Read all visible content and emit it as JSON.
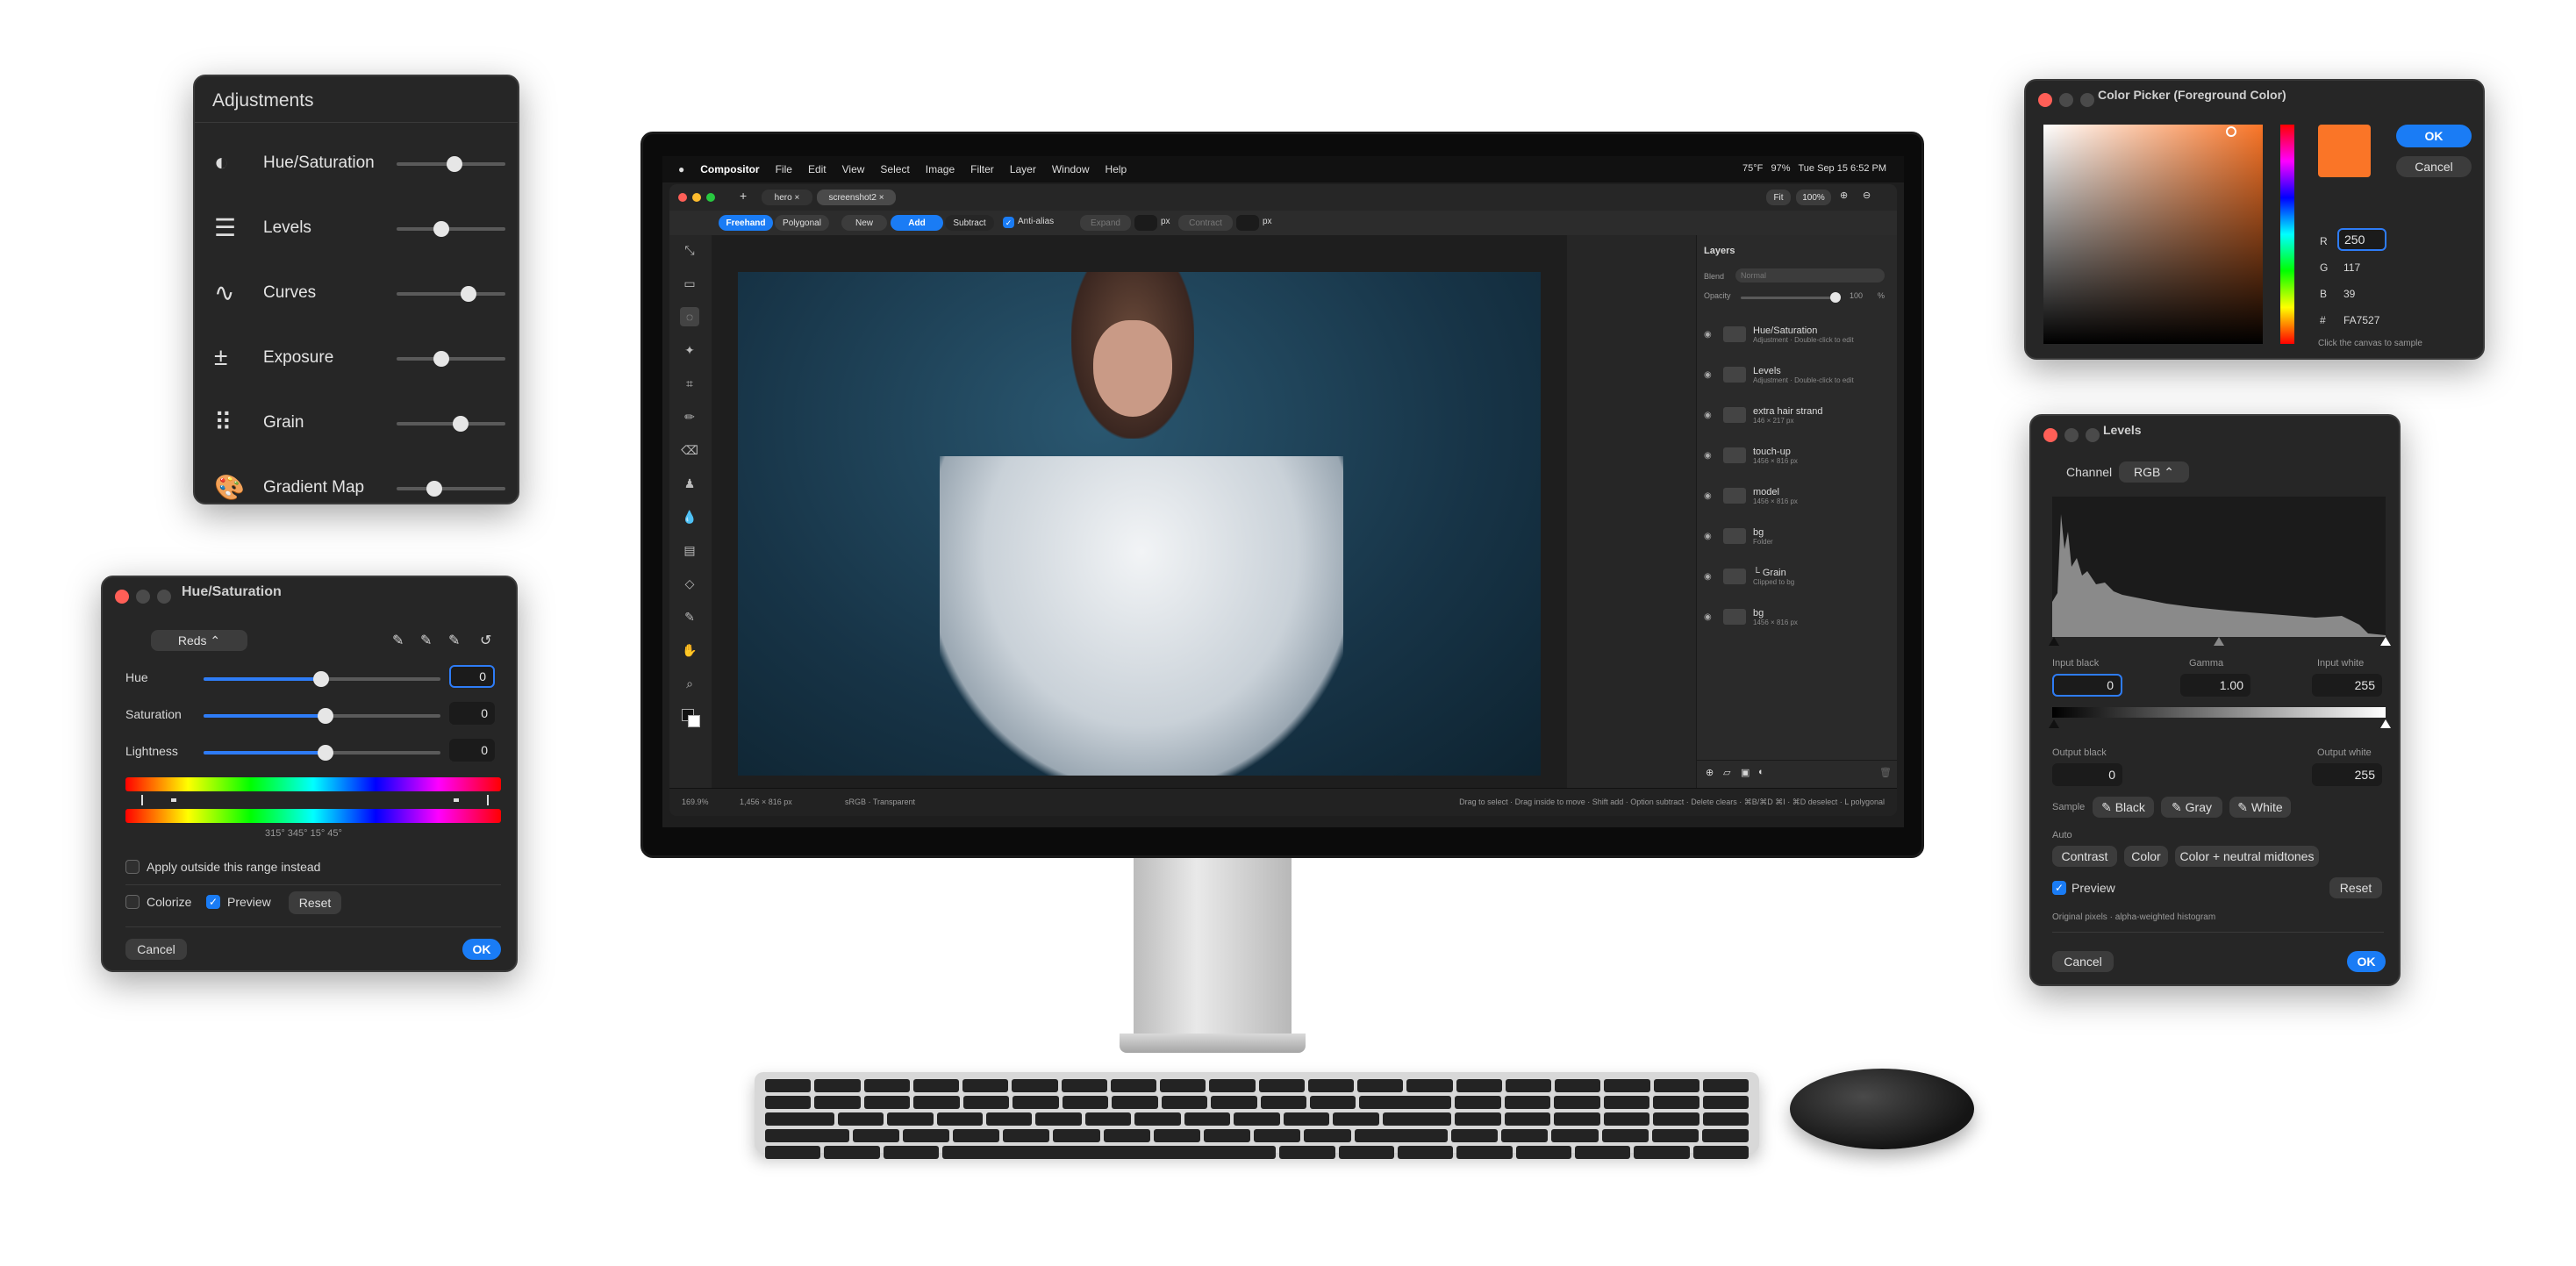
{
  "adjustments": {
    "title": "Adjustments",
    "items": [
      {
        "label": "Hue/Saturation",
        "icon": "half-circle-icon",
        "level": 0.53
      },
      {
        "label": "Levels",
        "icon": "sliders-icon",
        "level": 0.41
      },
      {
        "label": "Curves",
        "icon": "curve-icon",
        "level": 0.66
      },
      {
        "label": "Exposure",
        "icon": "plus-minus-icon",
        "level": 0.41
      },
      {
        "label": "Grain",
        "icon": "dots-grid-icon",
        "level": 0.59
      },
      {
        "label": "Gradient Map",
        "icon": "palette-icon",
        "level": 0.35
      }
    ]
  },
  "hue_sat": {
    "title": "Hue/Saturation",
    "channel": "Reds",
    "hue_label": "Hue",
    "hue_value": "0",
    "saturation_label": "Saturation",
    "saturation_value": "0",
    "lightness_label": "Lightness",
    "lightness_value": "0",
    "range_degrees": "315°  345°  15°  45°",
    "apply_outside": "Apply outside this range instead",
    "colorize": "Colorize",
    "preview": "Preview",
    "reset": "Reset",
    "cancel": "Cancel",
    "ok": "OK"
  },
  "color_picker": {
    "title": "Color Picker (Foreground Color)",
    "ok": "OK",
    "cancel": "Cancel",
    "r_label": "R",
    "r": "250",
    "g_label": "G",
    "g": "117",
    "b_label": "B",
    "b": "39",
    "hex_label": "#",
    "hex": "FA7527",
    "hint": "Click the canvas to sample",
    "swatch": "#FA7527"
  },
  "levels": {
    "title": "Levels",
    "channel_label": "Channel",
    "channel": "RGB",
    "input_black_label": "Input black",
    "input_black": "0",
    "gamma_label": "Gamma",
    "gamma": "1.00",
    "input_white_label": "Input white",
    "input_white": "255",
    "output_black_label": "Output black",
    "output_black": "0",
    "output_white_label": "Output white",
    "output_white": "255",
    "sample_label": "Sample",
    "black": "Black",
    "gray": "Gray",
    "white": "White",
    "auto_label": "Auto",
    "contrast": "Contrast",
    "color": "Color",
    "color_neutral": "Color + neutral midtones",
    "preview": "Preview",
    "reset": "Reset",
    "note": "Original pixels · alpha-weighted histogram",
    "cancel": "Cancel",
    "ok": "OK"
  },
  "app": {
    "menubar": [
      "Compositor",
      "File",
      "Edit",
      "View",
      "Select",
      "Image",
      "Filter",
      "Layer",
      "Window",
      "Help"
    ],
    "status_right": "Tue Sep 15  6:52 PM",
    "battery": "97%",
    "temp": "75°F",
    "tabs": [
      "hero",
      "screenshot2"
    ],
    "fit": "Fit",
    "zoom": "100%",
    "toolbar": {
      "freehand": "Freehand",
      "polygonal": "Polygonal",
      "new": "New",
      "add": "Add",
      "subtract": "Subtract",
      "anti_alias": "Anti-alias",
      "expand": "Expand",
      "px1": "px",
      "contract": "Contract",
      "px2": "px"
    },
    "layers_panel": {
      "title": "Layers",
      "blend_label": "Blend",
      "blend": "Normal",
      "opacity_label": "Opacity",
      "opacity": "100",
      "opacity_unit": "%",
      "layers": [
        {
          "name": "Hue/Saturation",
          "sub": "Adjustment · Double-click to edit"
        },
        {
          "name": "Levels",
          "sub": "Adjustment · Double-click to edit"
        },
        {
          "name": "extra hair strand",
          "sub": "146 × 217 px"
        },
        {
          "name": "touch-up",
          "sub": "1456 × 816 px"
        },
        {
          "name": "model",
          "sub": "1456 × 816 px"
        },
        {
          "name": "bg",
          "sub": "Folder"
        },
        {
          "name": "└ Grain",
          "sub": "Clipped to bg"
        },
        {
          "name": "bg",
          "sub": "1456 × 816 px"
        }
      ]
    },
    "status_left": "169.9%",
    "status_size": "1,456 × 816 px",
    "status_mode": "sRGB · Transparent",
    "status_hint": "Drag to select · Drag inside to move · Shift add · Option subtract · Delete clears · ⌘B/⌘D ⌘I · ⌘D deselect · L polygonal"
  }
}
